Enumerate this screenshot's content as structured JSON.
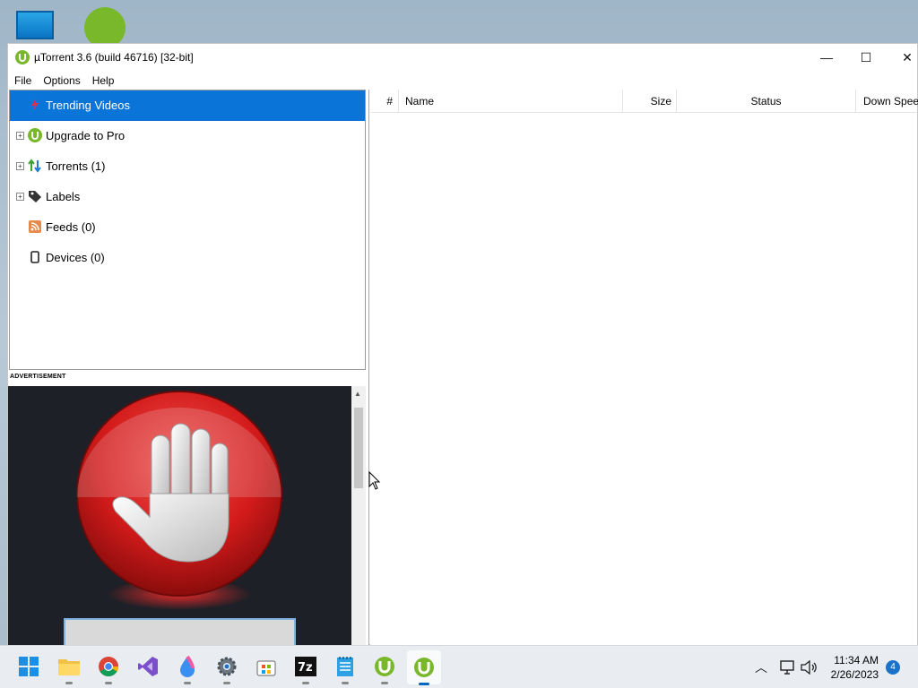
{
  "window": {
    "title": "µTorrent 3.6  (build 46716) [32-bit]",
    "controls": {
      "minimize": "—",
      "maximize": "☐",
      "close": "✕"
    }
  },
  "menu": [
    "File",
    "Options",
    "Help"
  ],
  "sidebar": {
    "items": [
      {
        "label": "Trending Videos",
        "icon": "trending-icon",
        "selected": true,
        "expandable": false
      },
      {
        "label": "Upgrade to Pro",
        "icon": "utorrent-icon",
        "selected": false,
        "expandable": true
      },
      {
        "label": "Torrents (1)",
        "icon": "torrents-arrows-icon",
        "selected": false,
        "expandable": true
      },
      {
        "label": "Labels",
        "icon": "tag-icon",
        "selected": false,
        "expandable": true
      },
      {
        "label": "Feeds (0)",
        "icon": "rss-icon",
        "selected": false,
        "expandable": false
      },
      {
        "label": "Devices (0)",
        "icon": "device-icon",
        "selected": false,
        "expandable": false
      }
    ]
  },
  "ad": {
    "label": "ADVERTISEMENT"
  },
  "list": {
    "columns": [
      "#",
      "Name",
      "Size",
      "Status",
      "Down Speed"
    ]
  },
  "taskbar": {
    "apps": [
      "start-icon",
      "file-explorer-icon",
      "chrome-icon",
      "visual-studio-icon",
      "paint-drop-icon",
      "settings-icon",
      "store-icon",
      "7zip-icon",
      "notepad-icon",
      "utorrent-icon",
      "utorrent-icon"
    ],
    "time": "11:34 AM",
    "date": "2/26/2023",
    "notifications": "4"
  },
  "colors": {
    "accent": "#0a74d8",
    "utorrent_green": "#78b82a",
    "ad_red": "#d41b1b"
  }
}
